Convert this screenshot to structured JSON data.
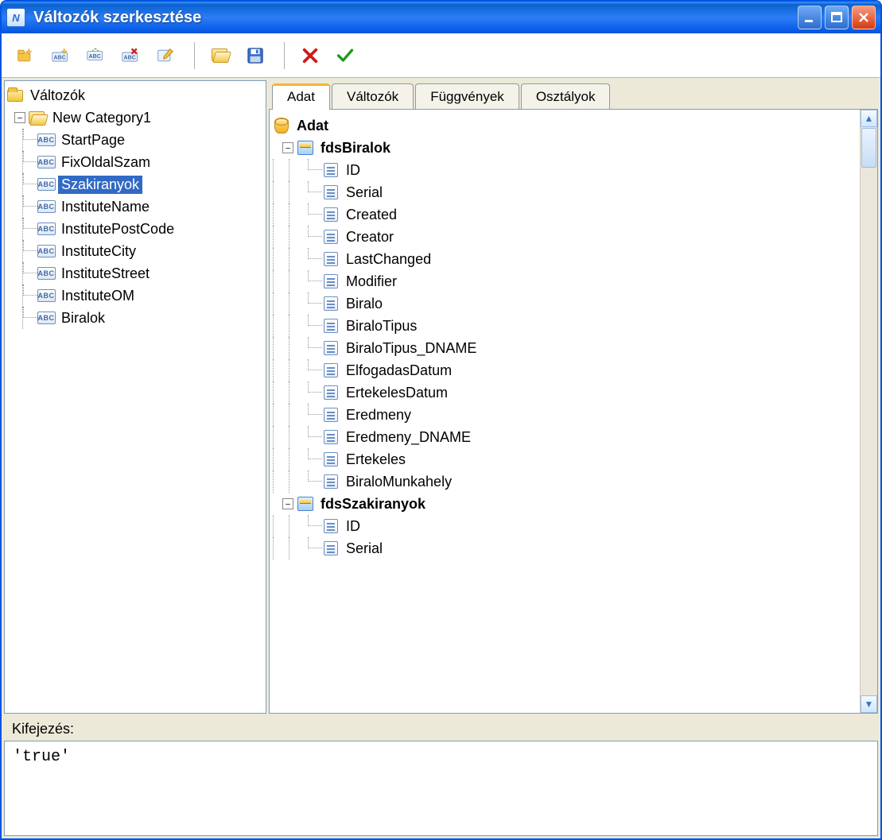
{
  "window": {
    "title": "Változók szerkesztése"
  },
  "toolbar": {
    "items": [
      "new-category",
      "new-variable",
      "edit-variable",
      "delete-variable",
      "rename",
      "|",
      "open",
      "save",
      "|",
      "cancel-x",
      "confirm-check"
    ]
  },
  "leftTree": {
    "root": "Változók",
    "category": "New Category1",
    "items": [
      "StartPage",
      "FixOldalSzam",
      "Szakiranyok",
      "InstituteName",
      "InstitutePostCode",
      "InstituteCity",
      "InstituteStreet",
      "InstituteOM",
      "Biralok"
    ],
    "selected": "Szakiranyok"
  },
  "tabs": [
    "Adat",
    "Változók",
    "Függvények",
    "Osztályok"
  ],
  "activeTab": "Adat",
  "dataTree": {
    "root": "Adat",
    "datasets": [
      {
        "name": "fdsBiralok",
        "fields": [
          "ID",
          "Serial",
          "Created",
          "Creator",
          "LastChanged",
          "Modifier",
          "Biralo",
          "BiraloTipus",
          "BiraloTipus_DNAME",
          "ElfogadasDatum",
          "ErtekelesDatum",
          "Eredmeny",
          "Eredmeny_DNAME",
          "Ertekeles",
          "BiraloMunkahely"
        ]
      },
      {
        "name": "fdsSzakiranyok",
        "fields": [
          "ID",
          "Serial"
        ]
      }
    ]
  },
  "expression": {
    "label": "Kifejezés:",
    "value": "'true'"
  }
}
